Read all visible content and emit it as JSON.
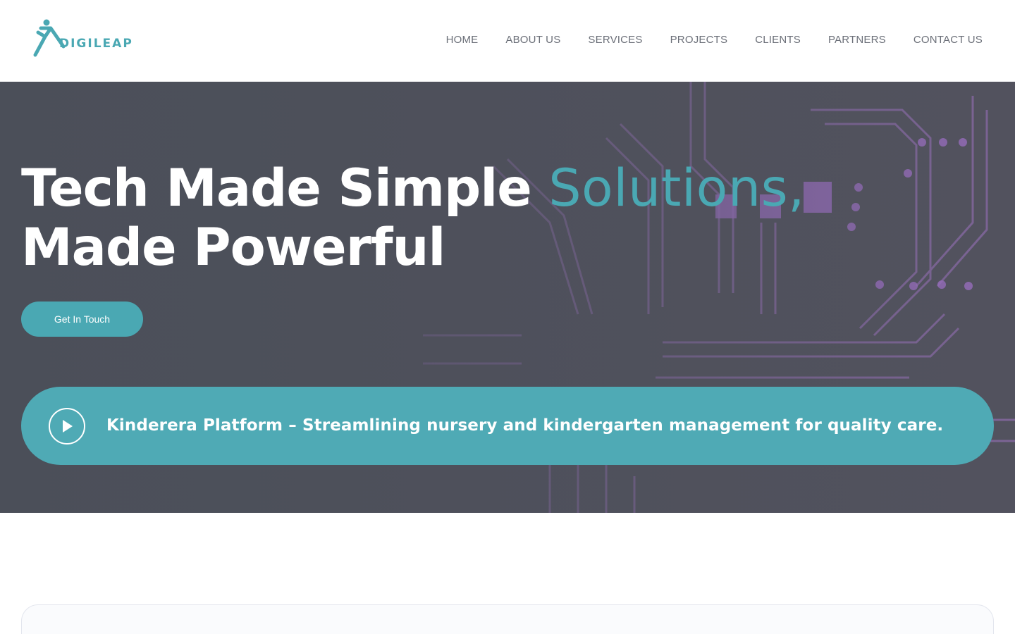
{
  "brand": {
    "name": "DIGILEAP",
    "color": "#4aa8b3",
    "logo_icon": "leaping-figure-icon"
  },
  "nav": {
    "items": [
      {
        "label": "HOME"
      },
      {
        "label": "ABOUT US"
      },
      {
        "label": "SERVICES"
      },
      {
        "label": "PROJECTS"
      },
      {
        "label": "CLIENTS"
      },
      {
        "label": "PARTNERS"
      },
      {
        "label": "CONTACT US"
      }
    ]
  },
  "hero": {
    "title_part1": "Tech Made Simple ",
    "title_accent": "Solutions,",
    "title_part2": " Made Powerful",
    "cta_label": "Get In Touch",
    "background_icon": "circuit-board-icon"
  },
  "banner": {
    "text": "Kinderera Platform – Streamlining nursery and kindergarten management for quality care.",
    "icon": "play-icon"
  },
  "colors": {
    "accent": "#4aa8b3",
    "hero_overlay": "#4b4f59",
    "nav_text": "#6b6f78"
  }
}
